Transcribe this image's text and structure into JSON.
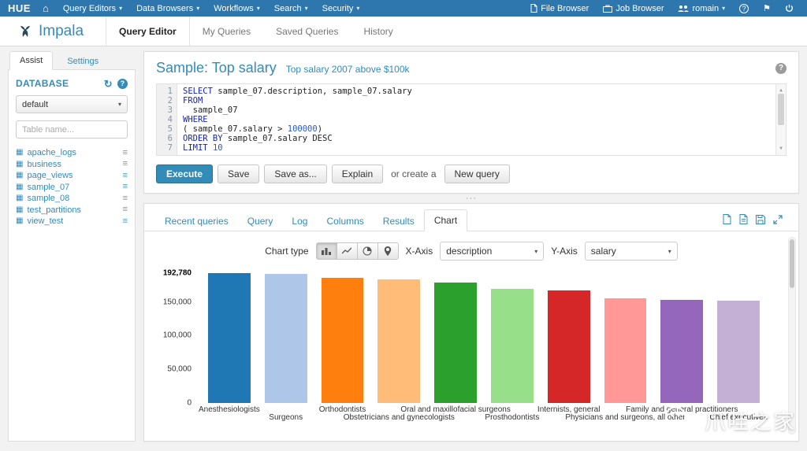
{
  "icons": {
    "caret": "▾",
    "home": "⌂",
    "flag": "⚑",
    "help": "?",
    "refresh": "↻",
    "table": "▦",
    "columns": "≡",
    "ellipsis": "···",
    "scroll_up": "▲",
    "scroll_down": "▼"
  },
  "colors": {
    "navbar": "#2d77ae",
    "accent": "#338bb8"
  },
  "navbar": {
    "logo": "HUE",
    "menus": [
      "Query Editors",
      "Data Browsers",
      "Workflows",
      "Search",
      "Security"
    ],
    "file_browser": "File Browser",
    "job_browser": "Job Browser",
    "user": "romain"
  },
  "app": {
    "name": "Impala",
    "tabs": [
      "Query Editor",
      "My Queries",
      "Saved Queries",
      "History"
    ],
    "active_tab": "Query Editor"
  },
  "assist": {
    "tabs": [
      "Assist",
      "Settings"
    ],
    "active_tab": "Assist",
    "section_title": "DATABASE",
    "database": "default",
    "filter_placeholder": "Table name...",
    "tables": [
      "apache_logs",
      "business",
      "page_views",
      "sample_07",
      "sample_08",
      "test_partitions",
      "view_test"
    ]
  },
  "query": {
    "title": "Sample: Top salary",
    "subtitle": "Top salary 2007 above $100k",
    "sql": [
      [
        [
          "kw",
          "SELECT"
        ],
        [
          "pl",
          " sample_07.description, sample_07.salary"
        ]
      ],
      [
        [
          "kw",
          "FROM"
        ]
      ],
      [
        [
          "pl",
          "  sample_07"
        ]
      ],
      [
        [
          "kw",
          "WHERE"
        ]
      ],
      [
        [
          "pl",
          "( sample_07.salary > "
        ],
        [
          "num",
          "100000"
        ],
        [
          "pl",
          ")"
        ]
      ],
      [
        [
          "kw",
          "ORDER BY"
        ],
        [
          "pl",
          " sample_07.salary DESC"
        ]
      ],
      [
        [
          "kw",
          "LIMIT"
        ],
        [
          "pl",
          " "
        ],
        [
          "num",
          "10"
        ]
      ]
    ],
    "actions": {
      "execute": "Execute",
      "save": "Save",
      "save_as": "Save as...",
      "explain": "Explain",
      "or_create": "or create a",
      "new_query": "New query"
    }
  },
  "results": {
    "tabs": [
      "Recent queries",
      "Query",
      "Log",
      "Columns",
      "Results",
      "Chart"
    ],
    "active_tab": "Chart",
    "chart_type_label": "Chart type",
    "x_axis_label": "X-Axis",
    "x_axis_value": "description",
    "y_axis_label": "Y-Axis",
    "y_axis_value": "salary"
  },
  "chart_data": {
    "type": "bar",
    "title": "",
    "xlabel": "description",
    "ylabel": "salary",
    "categories": [
      "Anesthesiologists",
      "Surgeons",
      "Orthodontists",
      "Obstetricians and gynecologists",
      "Oral and maxillofacial surgeons",
      "Prosthodontists",
      "Internists, general",
      "Physicians and surgeons, all other",
      "Family and general practitioners",
      "Chief executives"
    ],
    "values": [
      192780,
      191410,
      185340,
      183600,
      178440,
      169360,
      167270,
      155150,
      153640,
      151370
    ],
    "colors": [
      "#1f77b4",
      "#aec7e8",
      "#ff7f0e",
      "#ffbb78",
      "#2ca02c",
      "#98df8a",
      "#d62728",
      "#ff9896",
      "#9467bd",
      "#c5b0d5"
    ],
    "ylim": [
      0,
      192780
    ],
    "yticks": [
      0,
      50000,
      100000,
      150000
    ],
    "ytick_labels": [
      "0",
      "50,000",
      "100,000",
      "150,000"
    ],
    "ymax_label": "192,780",
    "grid": false,
    "legend": "none"
  },
  "watermark": {
    "text": "爪哇之家"
  }
}
